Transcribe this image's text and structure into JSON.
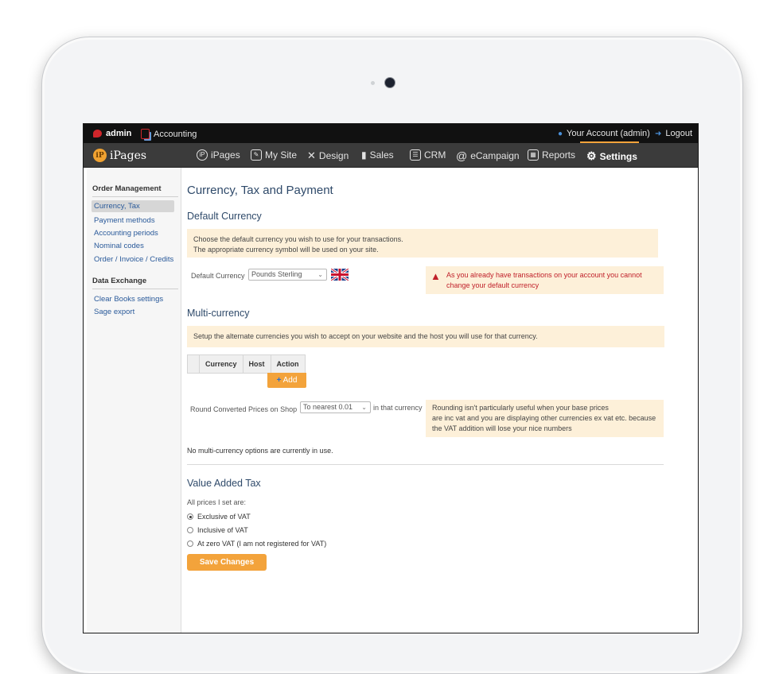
{
  "topbar": {
    "admin_label": "admin",
    "app_label": "Accounting",
    "account_label": "Your Account (admin)",
    "logout_label": "Logout"
  },
  "nav": {
    "logo_text": "iPages",
    "items": [
      {
        "label": "iPages",
        "icon": "ipages-icon"
      },
      {
        "label": "My Site",
        "icon": "edit-icon"
      },
      {
        "label": "Design",
        "icon": "design-icon"
      },
      {
        "label": "Sales",
        "icon": "sales-icon"
      },
      {
        "label": "CRM",
        "icon": "crm-icon"
      },
      {
        "label": "eCampaign",
        "icon": "at-icon"
      },
      {
        "label": "Reports",
        "icon": "chart-icon"
      },
      {
        "label": "Settings",
        "icon": "gear-icon"
      }
    ],
    "active": "Settings"
  },
  "sidebar": {
    "section1_title": "Order Management",
    "section1_items": [
      "Currency, Tax",
      "Payment methods",
      "Accounting periods",
      "Nominal codes",
      "Order / Invoice / Credits"
    ],
    "section2_title": "Data Exchange",
    "section2_items": [
      "Clear Books settings",
      "Sage export"
    ]
  },
  "main": {
    "page_title": "Currency, Tax and Payment",
    "default_currency": {
      "heading": "Default Currency",
      "note_line1": "Choose the default currency you wish to use for your transactions.",
      "note_line2": "The appropriate currency symbol will be used on your site.",
      "field_label": "Default Currency",
      "selected": "Pounds Sterling",
      "warning_line1": "As you already have transactions on your account you cannot",
      "warning_line2": "change your default currency"
    },
    "multi_currency": {
      "heading": "Multi-currency",
      "note": "Setup the alternate currencies you wish to accept on your website and the host you will use for that currency.",
      "columns": [
        "Currency",
        "Host",
        "Action"
      ],
      "add_label": "Add",
      "round_label": "Round Converted Prices on Shop",
      "round_selected": "To nearest 0.01",
      "round_suffix": "in that currency",
      "round_note_line1": "Rounding isn't particularly useful when your base prices",
      "round_note_line2": "are inc vat and you are displaying other currencies ex vat etc. because",
      "round_note_line3": "the VAT addition will lose your nice numbers",
      "empty_message": "No multi-currency options are currently in use."
    },
    "vat": {
      "heading": "Value Added Tax",
      "prompt": "All prices I set are:",
      "options": [
        "Exclusive of VAT",
        "Inclusive of VAT",
        "At zero VAT (I am not registered for VAT)"
      ],
      "selected_index": 0,
      "save_label": "Save Changes"
    }
  },
  "colors": {
    "accent": "#f3a33b",
    "warning": "#c0202a",
    "note_bg": "#fdf0d9",
    "nav_bg": "#3b3b3b"
  }
}
